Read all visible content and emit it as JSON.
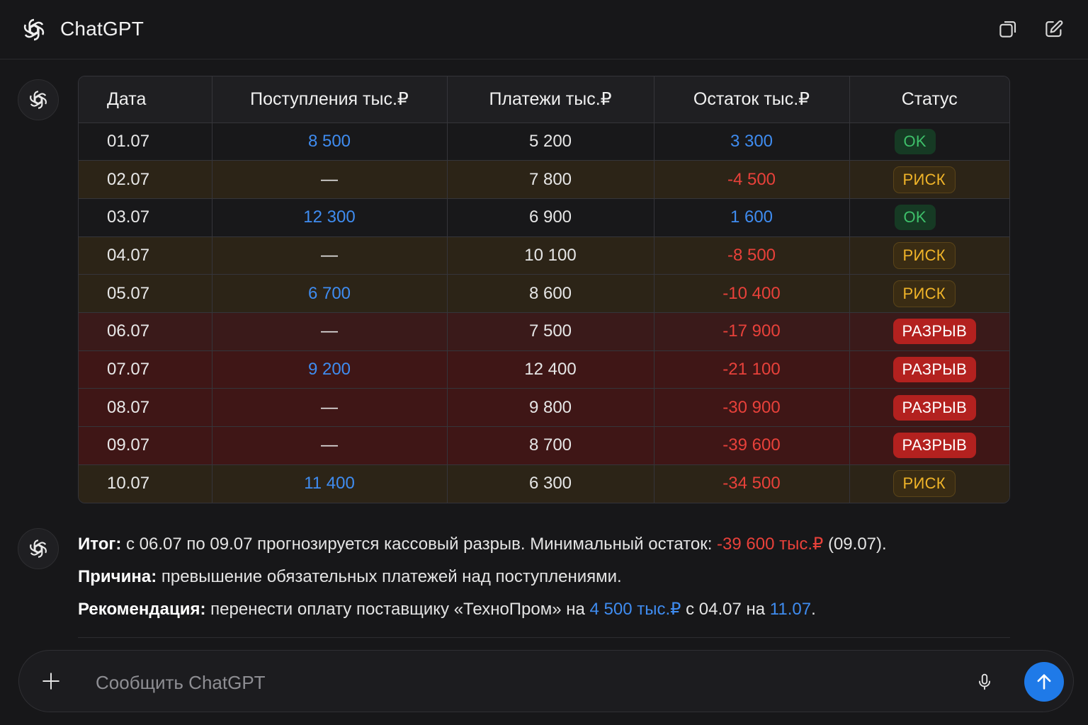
{
  "header": {
    "title": "ChatGPT",
    "logo_icon": "openai-logo-icon",
    "buttons": [
      "copy-window-icon",
      "edit-new-chat-icon"
    ]
  },
  "table": {
    "headers": [
      "Дата",
      "Поступления тыс.₽",
      "Платежи тыс.₽",
      "Остаток тыс.₽",
      "Статус"
    ],
    "rows": [
      {
        "date": "01.07",
        "inflow": "8 500",
        "payments": "5 200",
        "balance": "3 300",
        "status": "OK"
      },
      {
        "date": "02.07",
        "inflow": "—",
        "payments": "7 800",
        "balance": "-4 500",
        "status": "РИСК"
      },
      {
        "date": "03.07",
        "inflow": "12 300",
        "payments": "6 900",
        "balance": "1 600",
        "status": "OK"
      },
      {
        "date": "04.07",
        "inflow": "—",
        "payments": "10 100",
        "balance": "-8 500",
        "status": "РИСК"
      },
      {
        "date": "05.07",
        "inflow": "6 700",
        "payments": "8 600",
        "balance": "-10 400",
        "status": "РИСК"
      },
      {
        "date": "06.07",
        "inflow": "—",
        "payments": "7 500",
        "balance": "-17 900",
        "status": "РАЗРЫВ"
      },
      {
        "date": "07.07",
        "inflow": "9 200",
        "payments": "12 400",
        "balance": "-21 100",
        "status": "РАЗРЫВ"
      },
      {
        "date": "08.07",
        "inflow": "—",
        "payments": "9 800",
        "balance": "-30 900",
        "status": "РАЗРЫВ"
      },
      {
        "date": "09.07",
        "inflow": "—",
        "payments": "8 700",
        "balance": "-39 600",
        "status": "РАЗРЫВ"
      },
      {
        "date": "10.07",
        "inflow": "11 400",
        "payments": "6 300",
        "balance": "-34 500",
        "status": "РИСК"
      }
    ]
  },
  "summary": {
    "line1": {
      "label": "Итог:",
      "text": " с 06.07 по 09.07 прогнозируется кассовый разрыв. Минимальный остаток: ",
      "highlight": "-39 600 тыс.₽",
      "tail": " (09.07)."
    },
    "line2": {
      "label": "Причина:",
      "text": " превышение обязательных платежей над поступлениями."
    },
    "line3": {
      "label": "Рекомендация:",
      "text": " перенести оплату поставщику «ТехноПром» на ",
      "amount": "4 500 тыс.₽",
      "mid": " с 04.07 на ",
      "date": "11.07",
      "tail": "."
    }
  },
  "composer": {
    "placeholder": "Сообщить ChatGPT",
    "value": ""
  },
  "colors": {
    "accent_blue": "#3f8cf0",
    "negative_red": "#e8413a",
    "send_button": "#1f7ae8",
    "ok_green": "#3ec06a",
    "risk_amber": "#f0b429",
    "gap_red": "#b3211f"
  }
}
